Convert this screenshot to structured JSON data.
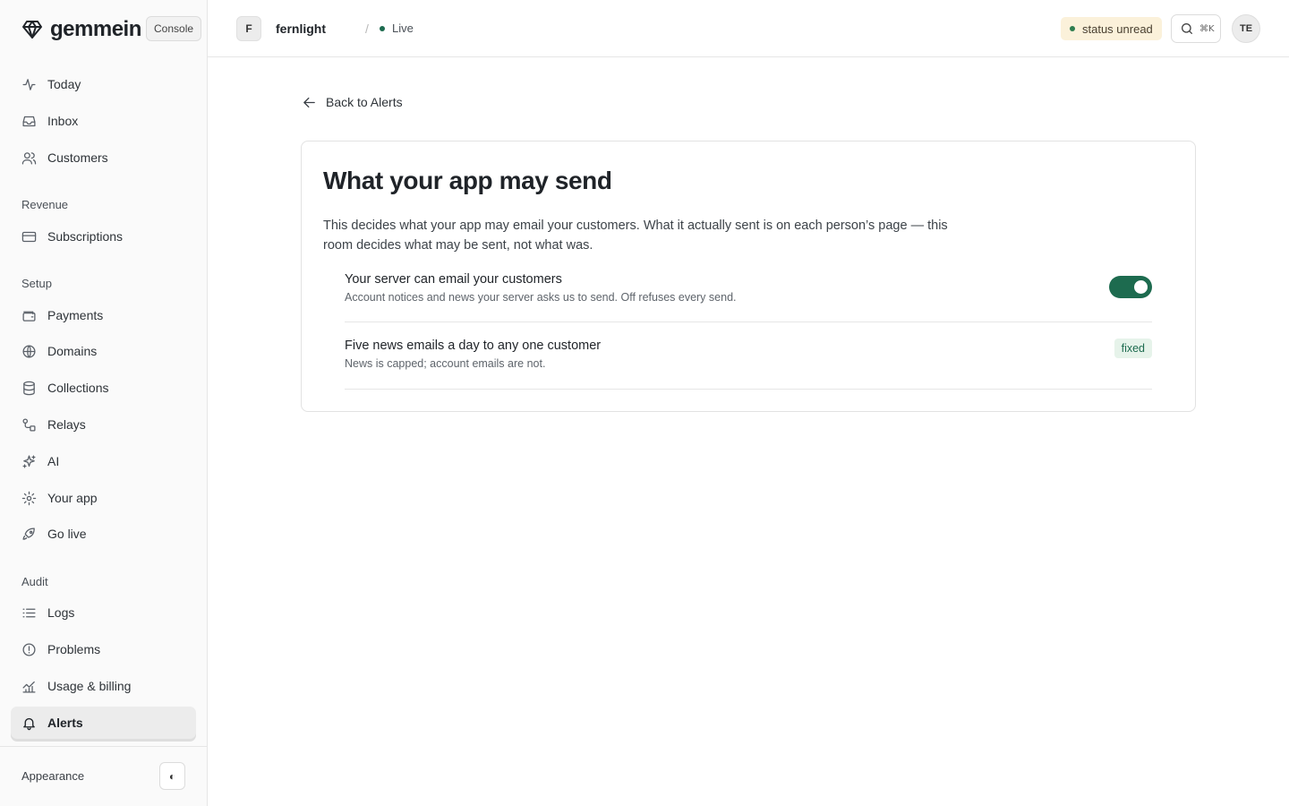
{
  "brand": {
    "name": "gemmein",
    "console_label": "Console"
  },
  "sidebar": {
    "top_items": [
      {
        "label": "Today",
        "icon": "activity-icon"
      },
      {
        "label": "Inbox",
        "icon": "inbox-icon"
      },
      {
        "label": "Customers",
        "icon": "users-icon"
      }
    ],
    "sections": [
      {
        "label": "Revenue",
        "items": [
          {
            "label": "Subscriptions",
            "icon": "credit-card-icon"
          }
        ]
      },
      {
        "label": "Setup",
        "items": [
          {
            "label": "Payments",
            "icon": "wallet-icon"
          },
          {
            "label": "Domains",
            "icon": "globe-icon"
          },
          {
            "label": "Collections",
            "icon": "database-icon"
          },
          {
            "label": "Relays",
            "icon": "relay-icon"
          },
          {
            "label": "AI",
            "icon": "sparkles-icon"
          },
          {
            "label": "Your app",
            "icon": "gear-icon"
          },
          {
            "label": "Go live",
            "icon": "rocket-icon"
          }
        ]
      },
      {
        "label": "Audit",
        "items": [
          {
            "label": "Logs",
            "icon": "list-icon"
          },
          {
            "label": "Problems",
            "icon": "alert-circle-icon"
          },
          {
            "label": "Usage & billing",
            "icon": "chart-icon"
          },
          {
            "label": "Alerts",
            "icon": "bell-icon",
            "active": true
          }
        ]
      }
    ],
    "appearance_label": "Appearance",
    "appearance_glyph": "◐"
  },
  "topbar": {
    "project_initial": "F",
    "project_name": "fernlight",
    "separator": "/",
    "environment": "Live",
    "status_label": "status unread",
    "search_shortcut": "⌘K",
    "user_initials": "TE"
  },
  "main": {
    "back_label": "Back to Alerts",
    "card": {
      "title": "What your app may send",
      "description": "This decides what your app may email your customers. What it actually sent is on each person’s page — this room decides what may be sent, not what was.",
      "settings": [
        {
          "title": "Your server can email your customers",
          "subtitle": "Account notices and news your server asks us to send. Off refuses every send.",
          "control": "toggle",
          "enabled": true
        },
        {
          "title": "Five news emails a day to any one customer",
          "subtitle": "News is capped; account emails are not.",
          "control": "badge",
          "badge_label": "fixed"
        }
      ]
    }
  },
  "colors": {
    "accent": "#1d6b4f",
    "status_bg": "#fbf1da",
    "badge_bg": "#e6f3ea"
  }
}
